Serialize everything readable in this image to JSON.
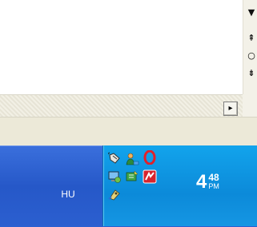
{
  "taskbar": {
    "language": "HU"
  },
  "tray": {
    "icons": [
      "mouse-icon",
      "network-user-icon",
      "opera-icon",
      "display-settings-icon",
      "sync-icon",
      "antivirus-icon",
      "usb-safely-remove-icon"
    ],
    "clock": {
      "hour": "4",
      "minutes": "48",
      "ampm": "PM"
    }
  },
  "scrollbar": {
    "down_glyph": "▼",
    "prev_page_glyph": "⇞",
    "select_browse_glyph": "○",
    "next_page_glyph": "⇟",
    "right_glyph": "▸"
  },
  "colors": {
    "taskbar": "#2658c8",
    "tray": "#0c8ad9",
    "window": "#ece9d8"
  }
}
